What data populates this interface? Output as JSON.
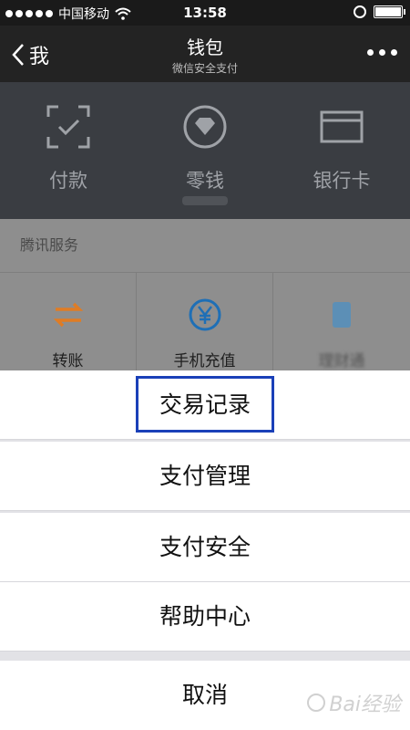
{
  "status_bar": {
    "carrier": "中国移动",
    "time": "13:58"
  },
  "nav": {
    "back_label": "我",
    "title": "钱包",
    "subtitle": "微信安全支付"
  },
  "wallet_tiles": [
    {
      "label": "付款",
      "icon": "scan-pay-icon"
    },
    {
      "label": "零钱",
      "icon": "diamond-coin-icon"
    },
    {
      "label": "银行卡",
      "icon": "bank-card-icon"
    }
  ],
  "services": {
    "header": "腾讯服务",
    "items": [
      {
        "label": "转账",
        "icon": "transfer-icon",
        "color": "#e07c24"
      },
      {
        "label": "手机充值",
        "icon": "yen-icon",
        "color": "#1e6fb6"
      },
      {
        "label": "理财通",
        "icon": "wealth-icon",
        "color": "#3a8fd0"
      }
    ]
  },
  "action_sheet": {
    "items": [
      {
        "label": "交易记录"
      },
      {
        "label": "支付管理"
      },
      {
        "label": "支付安全"
      },
      {
        "label": "帮助中心"
      }
    ],
    "cancel": "取消"
  },
  "watermark": "Bai经验",
  "colors": {
    "highlight": "#1a40b8",
    "nav_bg": "#232323",
    "wallet_bg": "#3a3d42"
  }
}
